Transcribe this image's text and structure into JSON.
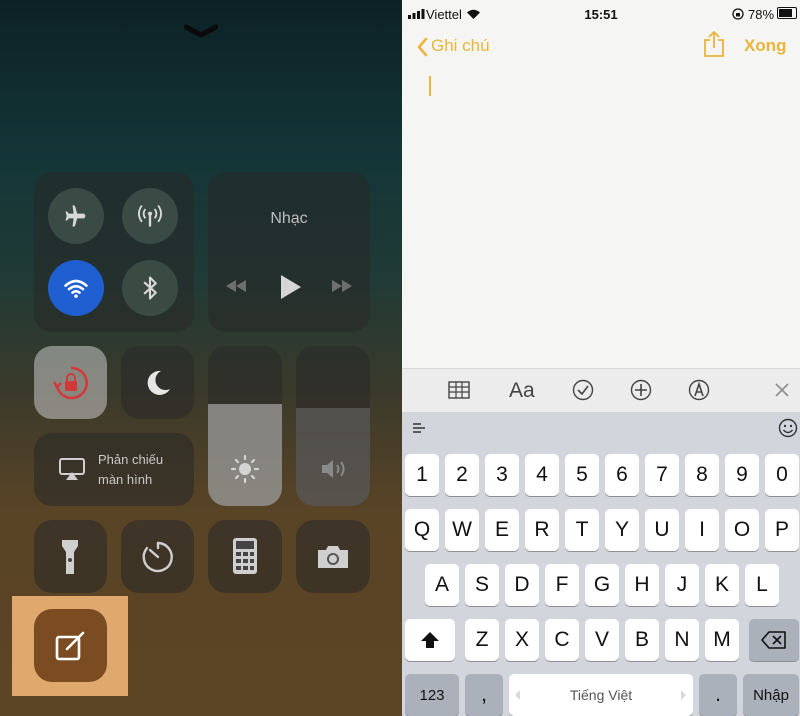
{
  "control_center": {
    "music_title": "Nhạc",
    "screen_mirroring_label": "Phản chiếu\nmàn hình"
  },
  "status_bar": {
    "carrier": "Viettel",
    "time": "15:51",
    "battery": "78%"
  },
  "notes_nav": {
    "back_label": "Ghi chú",
    "done_label": "Xong"
  },
  "keyboard": {
    "numbers": [
      "1",
      "2",
      "3",
      "4",
      "5",
      "6",
      "7",
      "8",
      "9",
      "0"
    ],
    "row1": [
      "Q",
      "W",
      "E",
      "R",
      "T",
      "Y",
      "U",
      "I",
      "O",
      "P"
    ],
    "row2": [
      "A",
      "S",
      "D",
      "F",
      "G",
      "H",
      "J",
      "K",
      "L"
    ],
    "row3": [
      "Z",
      "X",
      "C",
      "V",
      "B",
      "N",
      "M"
    ],
    "mode_key": "123",
    "comma": ",",
    "space_label": "Tiếng Việt",
    "period": ".",
    "return_label": "Nhập",
    "format_label": "Aa"
  }
}
